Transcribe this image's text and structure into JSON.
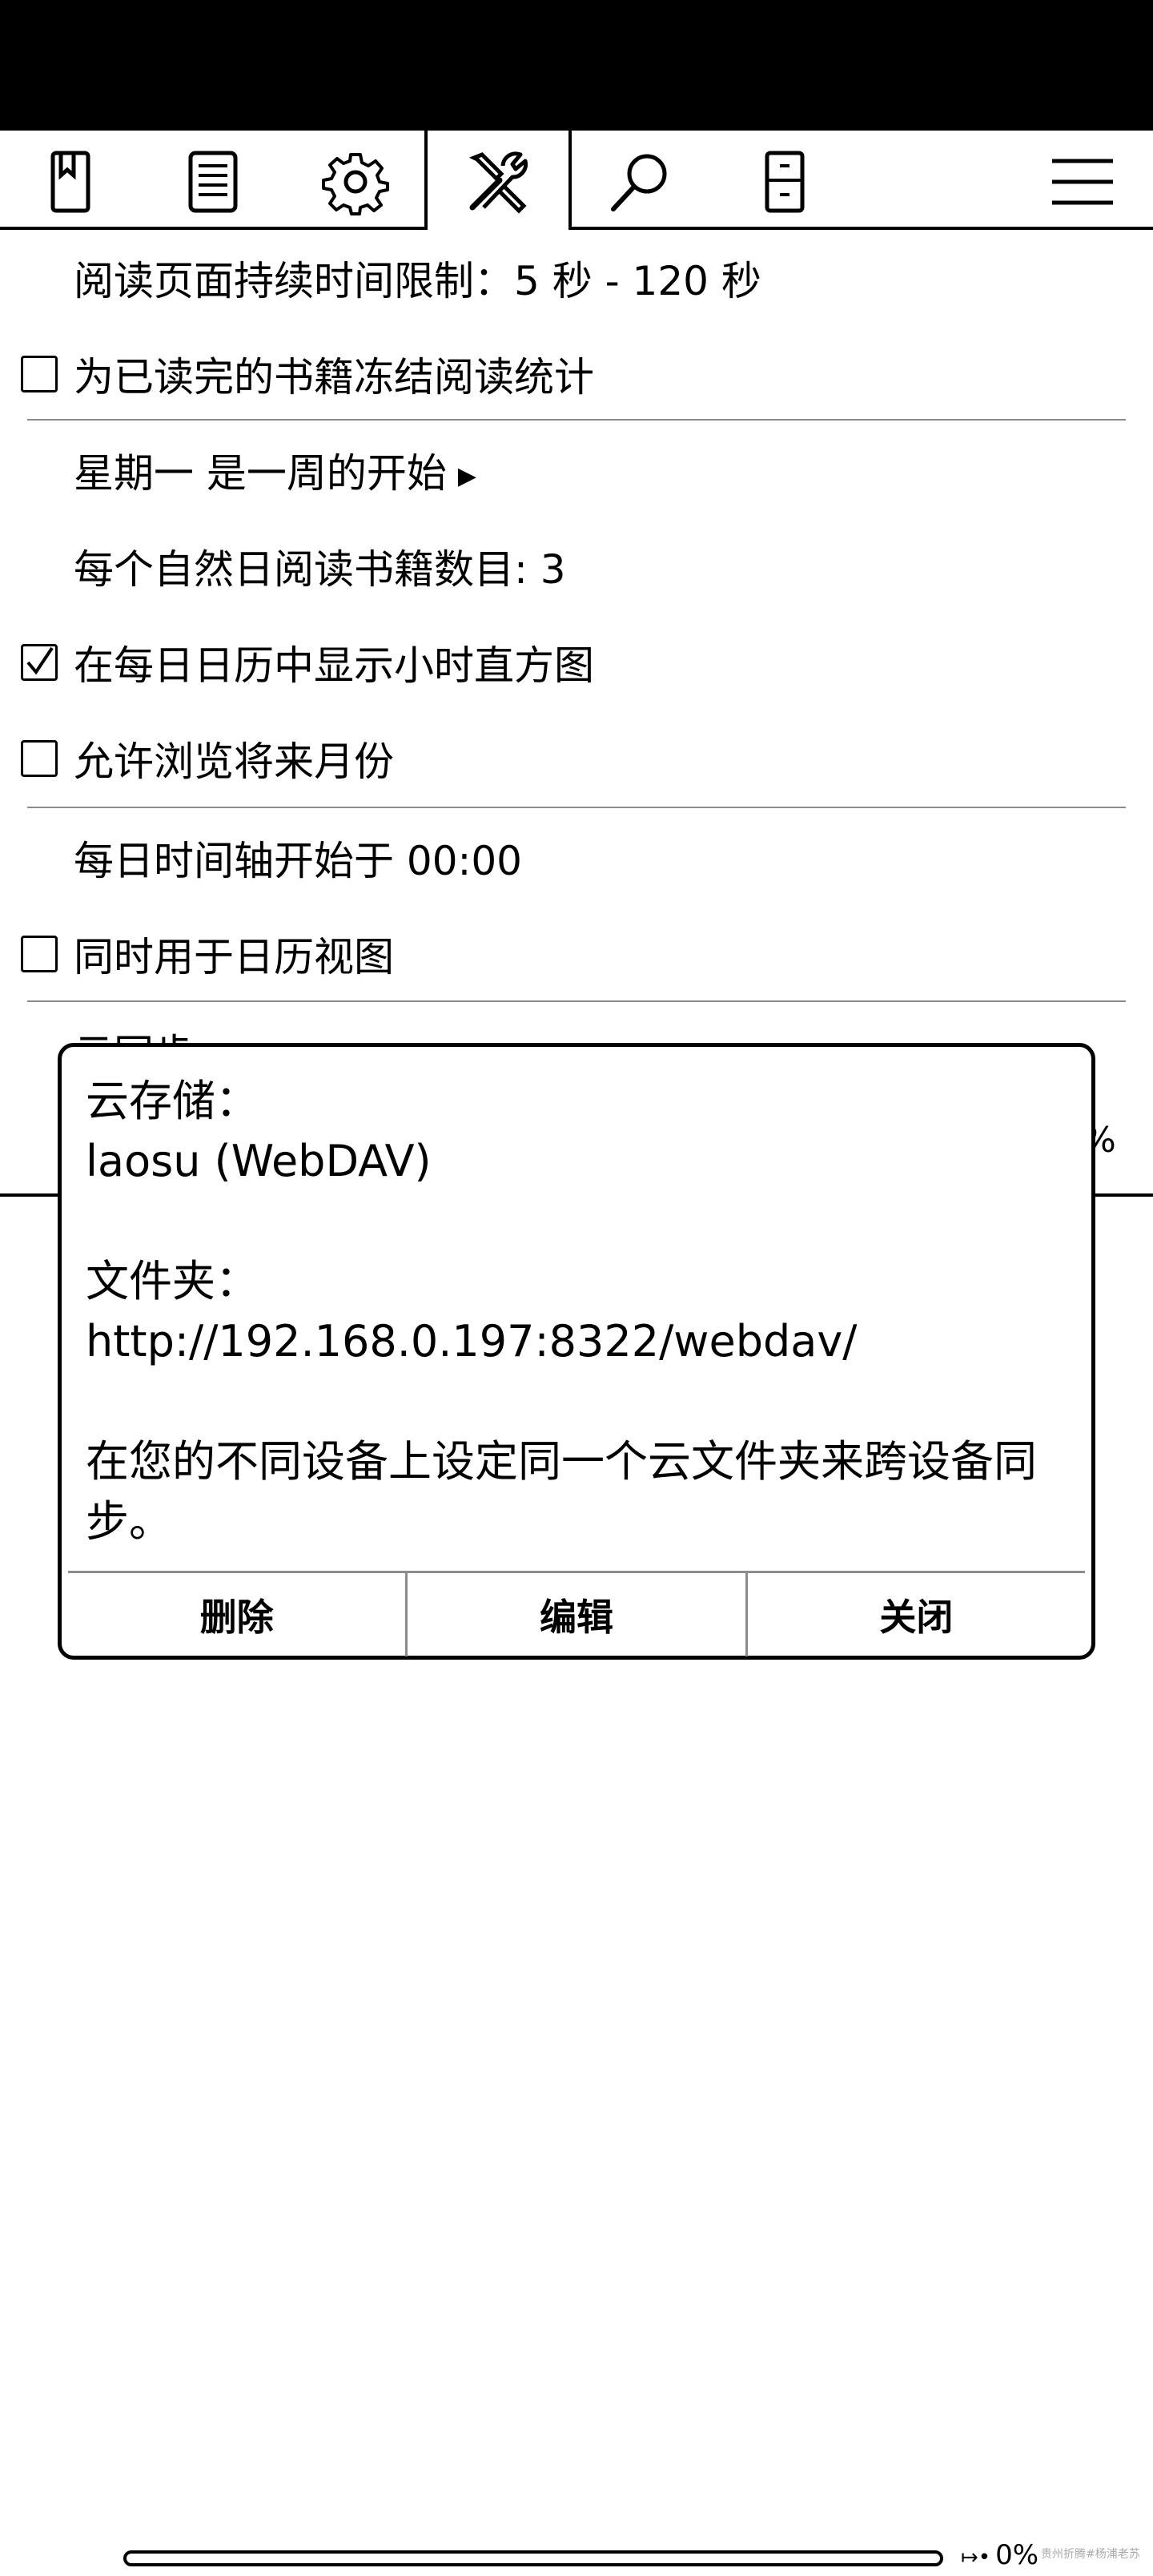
{
  "tabs": [
    {
      "icon": "bookmark-icon"
    },
    {
      "icon": "document-icon"
    },
    {
      "icon": "gear-icon"
    },
    {
      "icon": "tools-icon",
      "active": true
    },
    {
      "icon": "search-icon"
    },
    {
      "icon": "device-icon"
    },
    {
      "icon": "menu-icon"
    }
  ],
  "settings": {
    "time_limit": "阅读页面持续时间限制：5 秒 - 120 秒",
    "freeze_stats": {
      "label": "为已读完的书籍冻结阅读统计",
      "checked": false
    },
    "week_start": "星期一 是一周的开始",
    "books_per_day": "每个自然日阅读书籍数目: 3",
    "show_histogram": {
      "label": "在每日日历中显示小时直方图",
      "checked": true
    },
    "browse_future": {
      "label": "允许浏览将来月份",
      "checked": false
    },
    "timeline_start": "每日时间轴开始于 00:00",
    "also_calendar": {
      "label": "同时用于日历视图",
      "checked": false
    },
    "cloud_sync_peek": "云同步",
    "peek_pct": "%"
  },
  "dialog": {
    "storage_label": "云存储：",
    "storage_value": "laosu  (WebDAV)",
    "folder_label": "文件夹：",
    "folder_value": "http://192.168.0.197:8322/webdav/",
    "hint": "在您的不同设备上设定同一个云文件夹来跨设备同步。",
    "buttons": {
      "delete": "删除",
      "edit": "编辑",
      "close": "关闭"
    }
  },
  "footer": {
    "progress": 0,
    "progress_mark": "↦•",
    "progress_text": "0%",
    "watermark": "贵州折腾#杨浦老苏"
  }
}
